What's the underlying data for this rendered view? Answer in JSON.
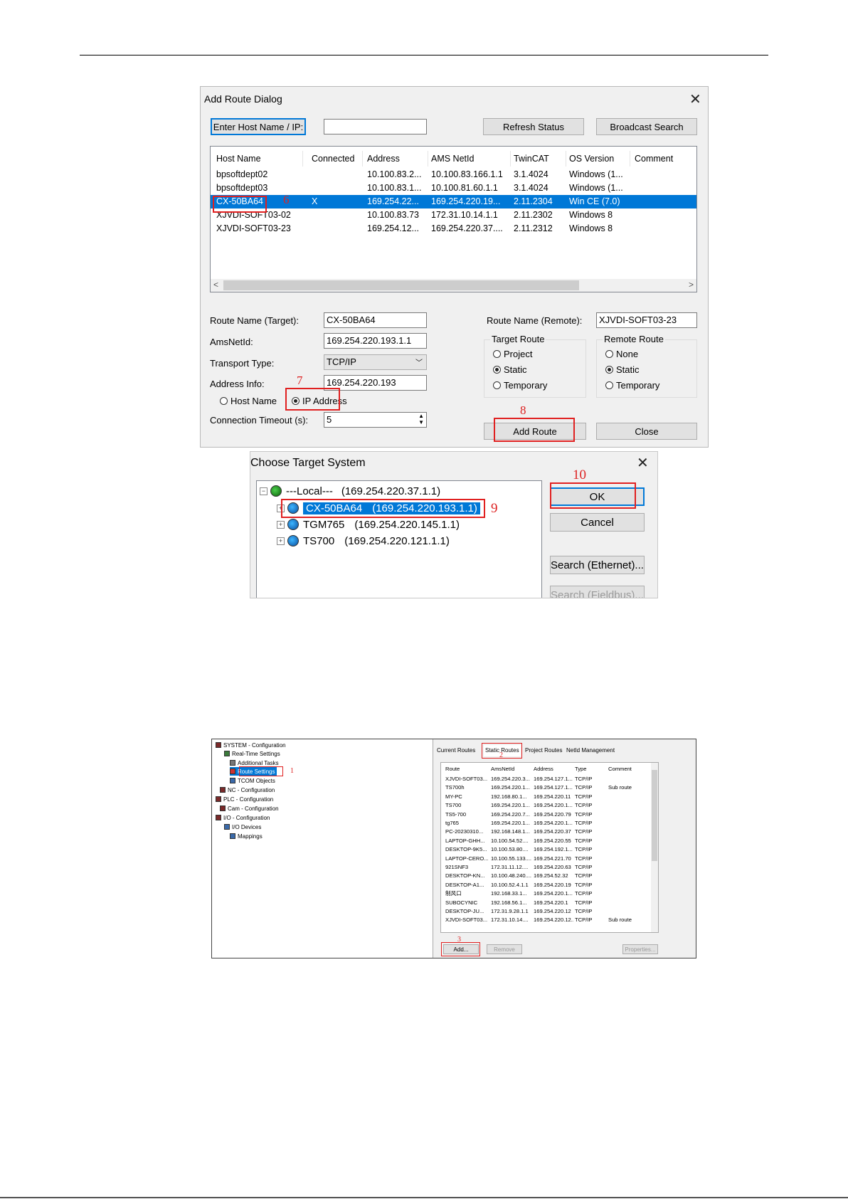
{
  "add_route": {
    "title": "Add Route Dialog",
    "enter_host_btn": "Enter Host Name / IP:",
    "host_input": "",
    "refresh_btn": "Refresh Status",
    "broadcast_btn": "Broadcast Search",
    "columns": [
      "Host Name",
      "Connected",
      "Address",
      "AMS NetId",
      "TwinCAT",
      "OS Version",
      "Comment"
    ],
    "rows": [
      [
        "bpsoftdept02",
        "",
        "10.100.83.2...",
        "10.100.83.166.1.1",
        "3.1.4024",
        "Windows (1...",
        ""
      ],
      [
        "bpsoftdept03",
        "",
        "10.100.83.1...",
        "10.100.81.60.1.1",
        "3.1.4024",
        "Windows (1...",
        ""
      ],
      [
        "CX-50BA64",
        "X",
        "169.254.22...",
        "169.254.220.19...",
        "2.11.2304",
        "Win CE (7.0)",
        ""
      ],
      [
        "XJVDI-SOFT03-02",
        "",
        "10.100.83.73",
        "172.31.10.14.1.1",
        "2.11.2302",
        "Windows 8",
        ""
      ],
      [
        "XJVDI-SOFT03-23",
        "",
        "169.254.12...",
        "169.254.220.37....",
        "2.11.2312",
        "Windows 8",
        ""
      ]
    ],
    "route_name_target_label": "Route Name (Target):",
    "route_name_target": "CX-50BA64",
    "amsnetid_label": "AmsNetId:",
    "amsnetid": "169.254.220.193.1.1",
    "transport_label": "Transport Type:",
    "transport": "TCP/IP",
    "address_info_label": "Address Info:",
    "address_info": "169.254.220.193",
    "host_name_radio": "Host Name",
    "ip_address_radio": "IP Address",
    "timeout_label": "Connection Timeout (s):",
    "timeout": "5",
    "route_name_remote_label": "Route Name (Remote):",
    "route_name_remote": "XJVDI-SOFT03-23",
    "target_route_title": "Target Route",
    "target_route_options": [
      "Project",
      "Static",
      "Temporary"
    ],
    "remote_route_title": "Remote Route",
    "remote_route_options": [
      "None",
      "Static",
      "Temporary"
    ],
    "add_route_btn": "Add Route",
    "close_btn": "Close",
    "annotations": [
      "6",
      "7",
      "8"
    ]
  },
  "choose_target": {
    "title": "Choose Target System",
    "nodes": [
      {
        "name": "---Local---",
        "netid": "(169.254.220.37.1.1)"
      },
      {
        "name": "CX-50BA64",
        "netid": "(169.254.220.193.1.1)"
      },
      {
        "name": "TGM765",
        "netid": "(169.254.220.145.1.1)"
      },
      {
        "name": "TS700",
        "netid": "(169.254.220.121.1.1)"
      }
    ],
    "ok_btn": "OK",
    "cancel_btn": "Cancel",
    "search_eth_btn": "Search (Ethernet)...",
    "search_fieldbus_btn": "Search (Fieldbus)...",
    "annotations": [
      "9",
      "10"
    ]
  },
  "route_settings": {
    "tree": [
      "SYSTEM - Configuration",
      "Real-Time Settings",
      "Additional Tasks",
      "Route Settings",
      "TCOM Objects",
      "NC - Configuration",
      "PLC - Configuration",
      "Cam - Configuration",
      "I/O - Configuration",
      "I/O Devices",
      "Mappings"
    ],
    "tabs": [
      "Current Routes",
      "Static Routes",
      "Project Routes",
      "NetId Management"
    ],
    "columns": [
      "Route",
      "AmsNetId",
      "Address",
      "Type",
      "Comment"
    ],
    "rows": [
      [
        "XJVDI-SOFT03...",
        "169.254.220.3...",
        "169.254.127.1...",
        "TCP/IP",
        ""
      ],
      [
        "TS700h",
        "169.254.220.1...",
        "169.254.127.1...",
        "TCP/IP",
        "Sub route"
      ],
      [
        "MY-PC",
        "192.168.80.1...",
        "169.254.220.11",
        "TCP/IP",
        ""
      ],
      [
        "TS700",
        "169.254.220.1...",
        "169.254.220.1...",
        "TCP/IP",
        ""
      ],
      [
        "TS5-700",
        "169.254.220.7...",
        "169.254.220.79",
        "TCP/IP",
        ""
      ],
      [
        "tg765",
        "169.254.220.1...",
        "169.254.220.1...",
        "TCP/IP",
        ""
      ],
      [
        "PC-20230310...",
        "192.168.148.1...",
        "169.254.220.37",
        "TCP/IP",
        ""
      ],
      [
        "LAPTOP-GHH...",
        "10.100.54.52....",
        "169.254.220.55",
        "TCP/IP",
        ""
      ],
      [
        "DESKTOP-9K5...",
        "10.100.53.80....",
        "169.254.192.1...",
        "TCP/IP",
        ""
      ],
      [
        "LAPTOP-CERO...",
        "10.100.55.133....",
        "169.254.221.70",
        "TCP/IP",
        ""
      ],
      [
        "921SNF3",
        "172.31.11.12....",
        "169.254.220.63",
        "TCP/IP",
        ""
      ],
      [
        "DESKTOP-KN...",
        "10.100.48.240....",
        "169.254.52.32",
        "TCP/IP",
        ""
      ],
      [
        "DESKTOP-A1...",
        "10.100.52.4.1.1",
        "169.254.220.19",
        "TCP/IP",
        ""
      ],
      [
        "制风口",
        "192.168.33.1...",
        "169.254.220.1...",
        "TCP/IP",
        ""
      ],
      [
        "SUBOCYNIC",
        "192.168.56.1...",
        "169.254.220.1",
        "TCP/IP",
        ""
      ],
      [
        "DESKTOP-JU...",
        "172.31.9.28.1.1",
        "169.254.220.12",
        "TCP/IP",
        ""
      ],
      [
        "XJVDI-SOFT03...",
        "172.31.10.14....",
        "169.254.220.12...",
        "TCP/IP",
        "Sub route"
      ]
    ],
    "add_btn": "Add...",
    "remove_btn": "Remove",
    "properties_btn": "Properties...",
    "annotations": [
      "1",
      "2",
      "3"
    ]
  }
}
